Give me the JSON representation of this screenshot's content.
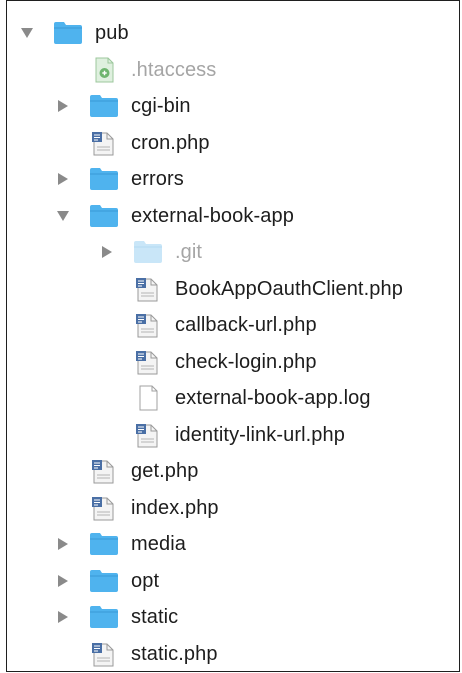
{
  "tree": {
    "root": {
      "label": "pub",
      "expanded": true,
      "icon": "folder-icon"
    },
    "items": [
      {
        "label": ".htaccess",
        "type": "file-generic-green",
        "icon": "htaccess-file-icon",
        "dim": true
      },
      {
        "label": "cgi-bin",
        "type": "folder",
        "expanded": false
      },
      {
        "label": "cron.php",
        "type": "php"
      },
      {
        "label": "errors",
        "type": "folder",
        "expanded": false
      },
      {
        "label": "external-book-app",
        "type": "folder",
        "expanded": true
      },
      {
        "label": ".git",
        "type": "folder",
        "expanded": false,
        "dim": true,
        "level": 2
      },
      {
        "label": "BookAppOauthClient.php",
        "type": "php",
        "level": 2
      },
      {
        "label": "callback-url.php",
        "type": "php",
        "level": 2
      },
      {
        "label": "check-login.php",
        "type": "php",
        "level": 2
      },
      {
        "label": "external-book-app.log",
        "type": "text",
        "level": 2
      },
      {
        "label": "identity-link-url.php",
        "type": "php",
        "level": 2
      },
      {
        "label": "get.php",
        "type": "php"
      },
      {
        "label": "index.php",
        "type": "php"
      },
      {
        "label": "media",
        "type": "folder",
        "expanded": false
      },
      {
        "label": "opt",
        "type": "folder",
        "expanded": false
      },
      {
        "label": "static",
        "type": "folder",
        "expanded": false
      },
      {
        "label": "static.php",
        "type": "php"
      }
    ]
  },
  "colors": {
    "folder": "#4fb3ee",
    "folder_dim": "#c9e6f8",
    "disclosure": "#8a8a8a",
    "text": "#1d1d1d",
    "dim_text": "#a5a5a5"
  }
}
